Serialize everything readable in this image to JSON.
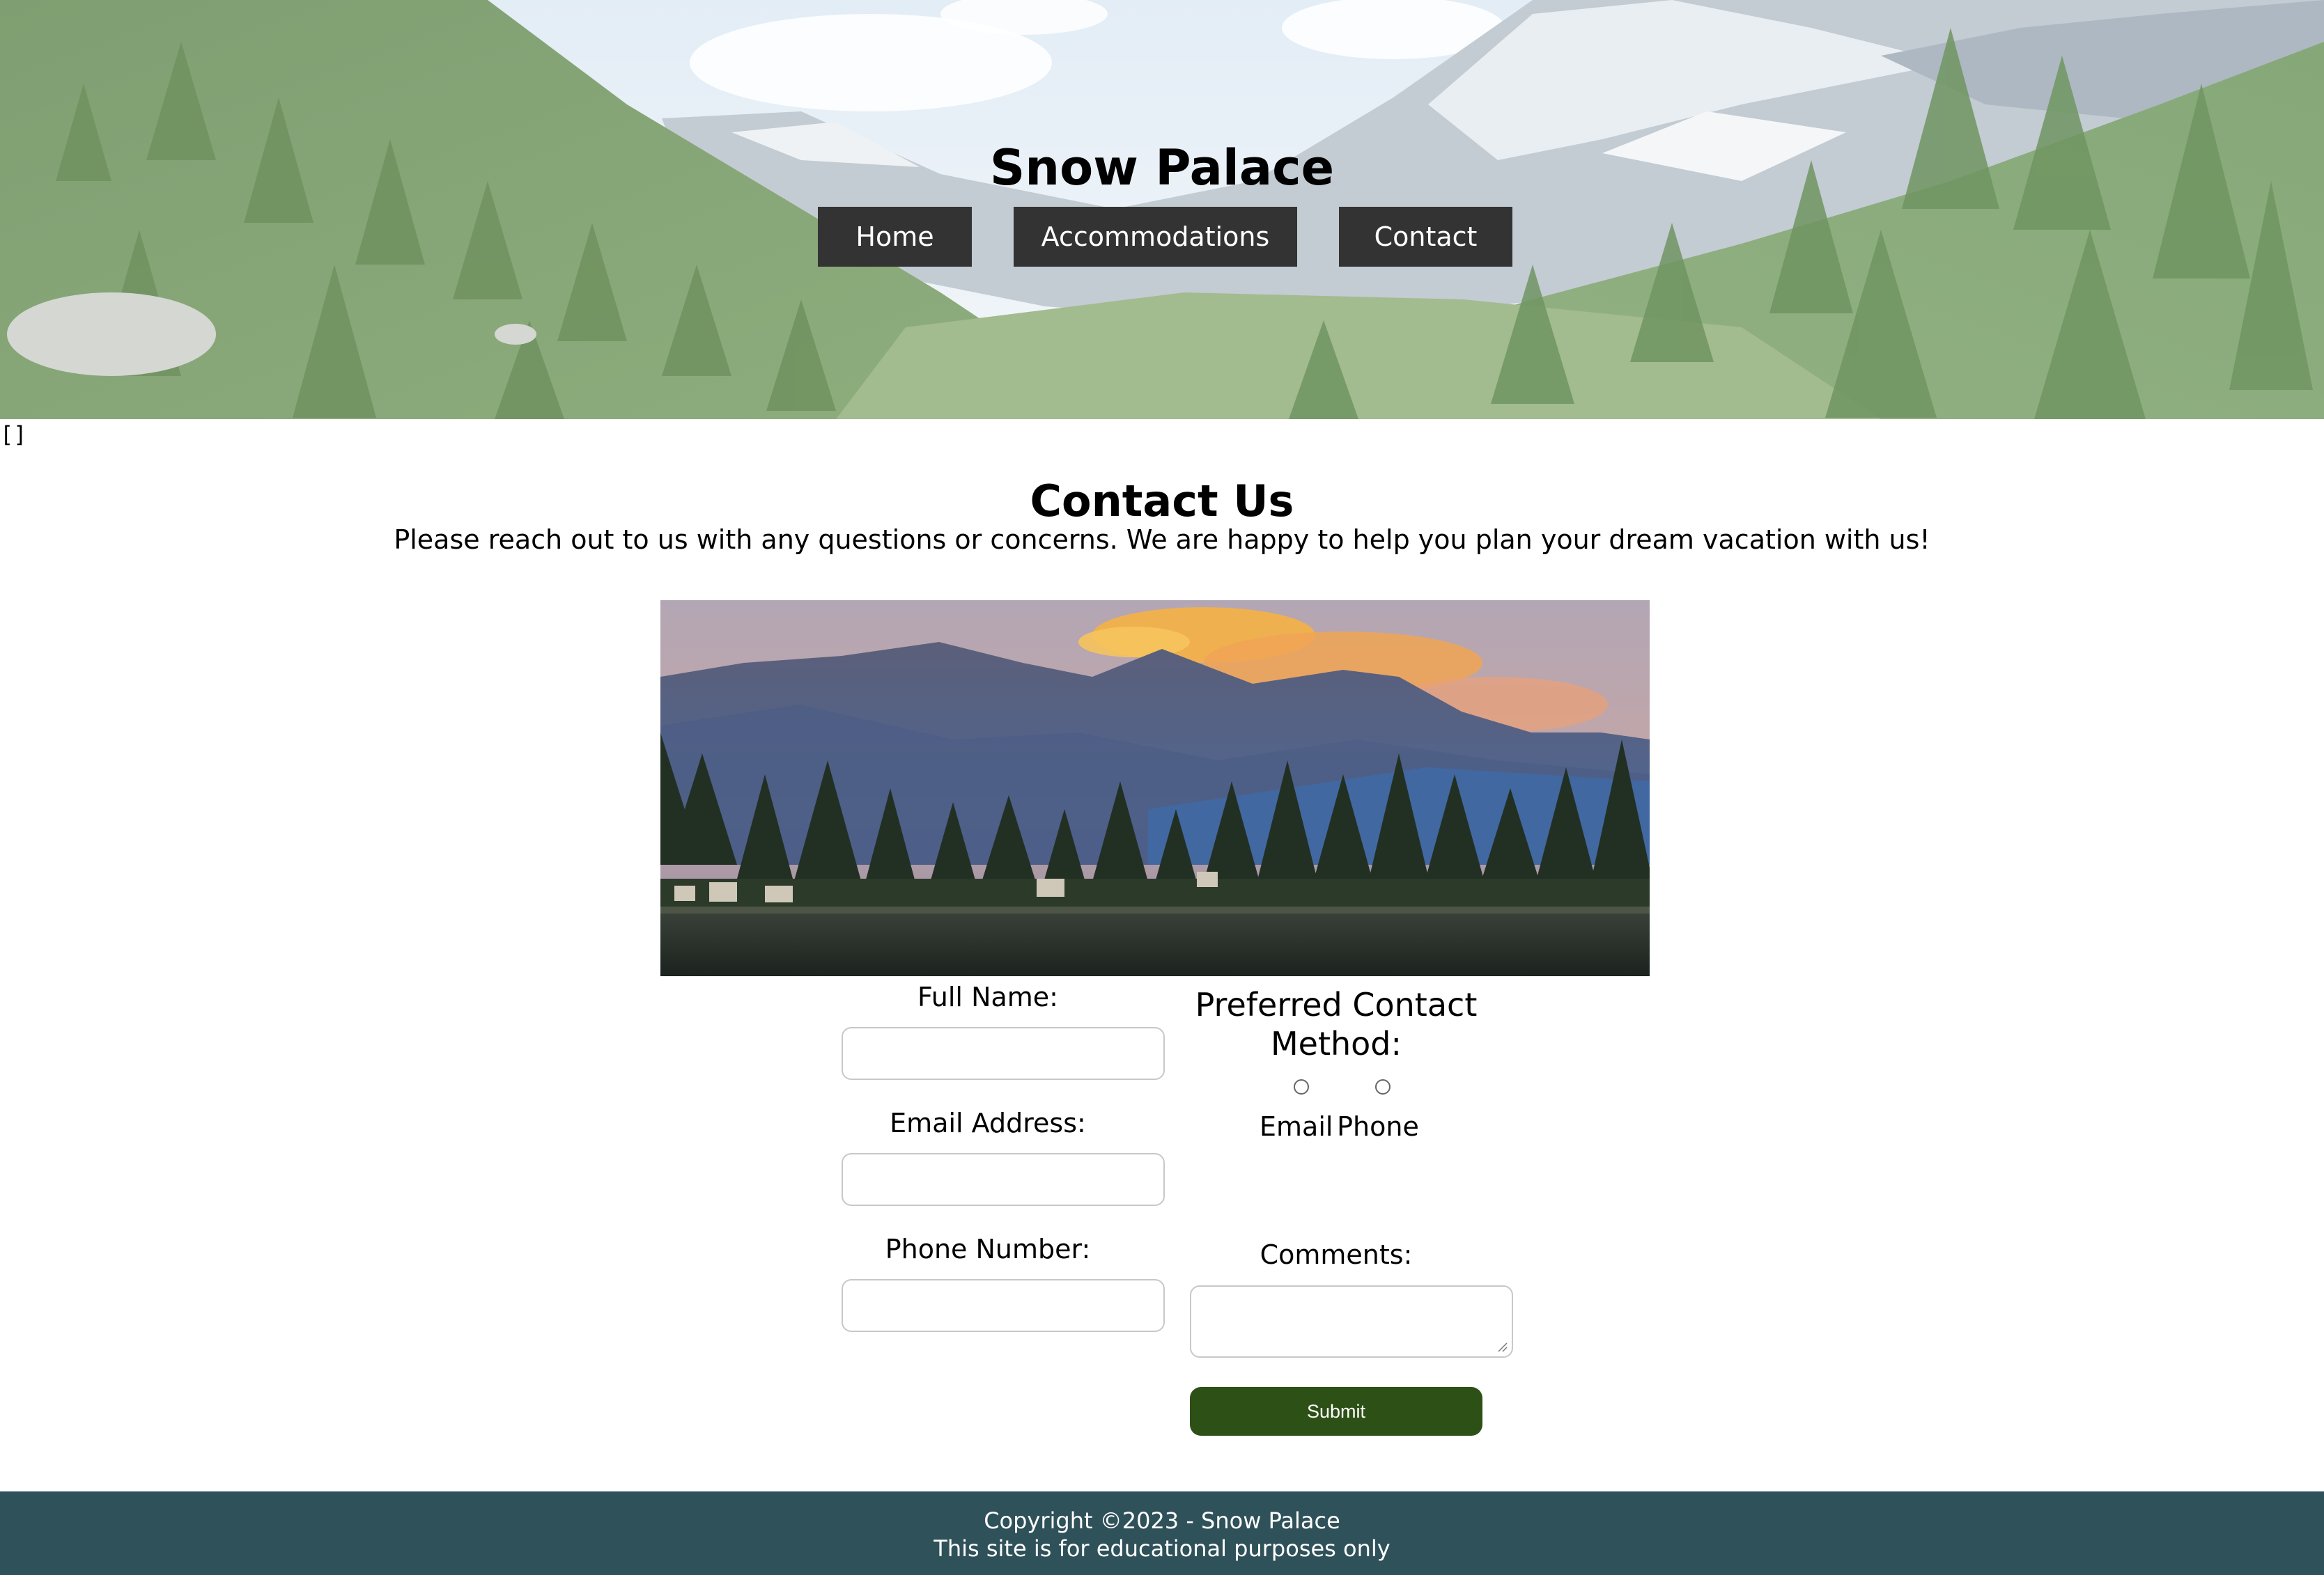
{
  "header": {
    "site_title": "Snow Palace",
    "nav": [
      {
        "label": "Home"
      },
      {
        "label": "Accommodations"
      },
      {
        "label": "Contact"
      }
    ],
    "stray_text": "[]"
  },
  "contact": {
    "heading": "Contact Us",
    "intro": "Please reach out to us with any questions or concerns. We are happy to help you plan your dream vacation with us!"
  },
  "form": {
    "full_name_label": "Full Name:",
    "full_name_value": "",
    "email_label": "Email Address:",
    "email_value": "",
    "phone_label": "Phone Number:",
    "phone_value": "",
    "preferred_contact_label_line1": "Preferred Contact",
    "preferred_contact_label_line2": "Method:",
    "radio_options": [
      {
        "label": "Email",
        "checked": false
      },
      {
        "label": "Phone",
        "checked": false
      }
    ],
    "comments_label": "Comments:",
    "comments_value": "",
    "submit_label": "Submit"
  },
  "footer": {
    "line1": "Copyright ©2023 - Snow Palace",
    "line2": "This site is for educational purposes only"
  },
  "colors": {
    "nav_bg": "#333333",
    "submit_bg": "#2d5016",
    "footer_bg": "#2f5159"
  },
  "images": {
    "hero": "mountain-valley-forest-photo",
    "contact": "mountain-lake-sunset-photo"
  }
}
